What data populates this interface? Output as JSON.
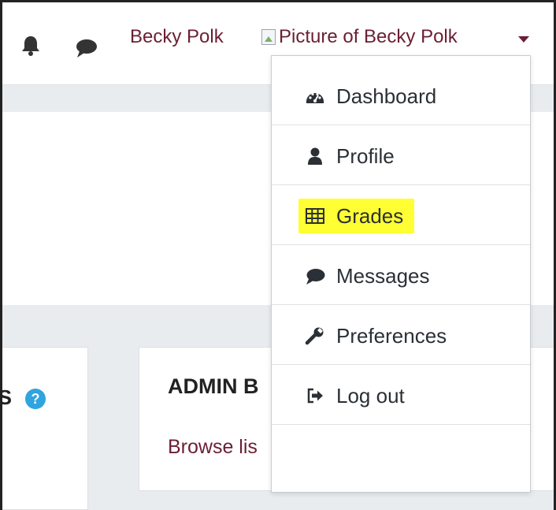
{
  "header": {
    "user_name": "Becky Polk",
    "avatar_alt": "Picture of Becky Polk",
    "notifications_icon": "bell-icon",
    "messages_icon": "chat-icon"
  },
  "user_menu": {
    "items": [
      {
        "label": "Dashboard",
        "icon": "dashboard-icon"
      },
      {
        "label": "Profile",
        "icon": "user-icon"
      },
      {
        "label": "Grades",
        "icon": "table-icon",
        "highlighted": true
      },
      {
        "label": "Messages",
        "icon": "chat-icon"
      },
      {
        "label": "Preferences",
        "icon": "wrench-icon"
      },
      {
        "label": "Log out",
        "icon": "sign-out-icon"
      }
    ]
  },
  "blocks": {
    "left_title_fragment": "S",
    "admin_title": "ADMIN B",
    "admin_link": "Browse lis"
  },
  "colors": {
    "accent": "#6b1f34",
    "highlight": "#ffff33",
    "help_icon": "#2fa4de"
  }
}
